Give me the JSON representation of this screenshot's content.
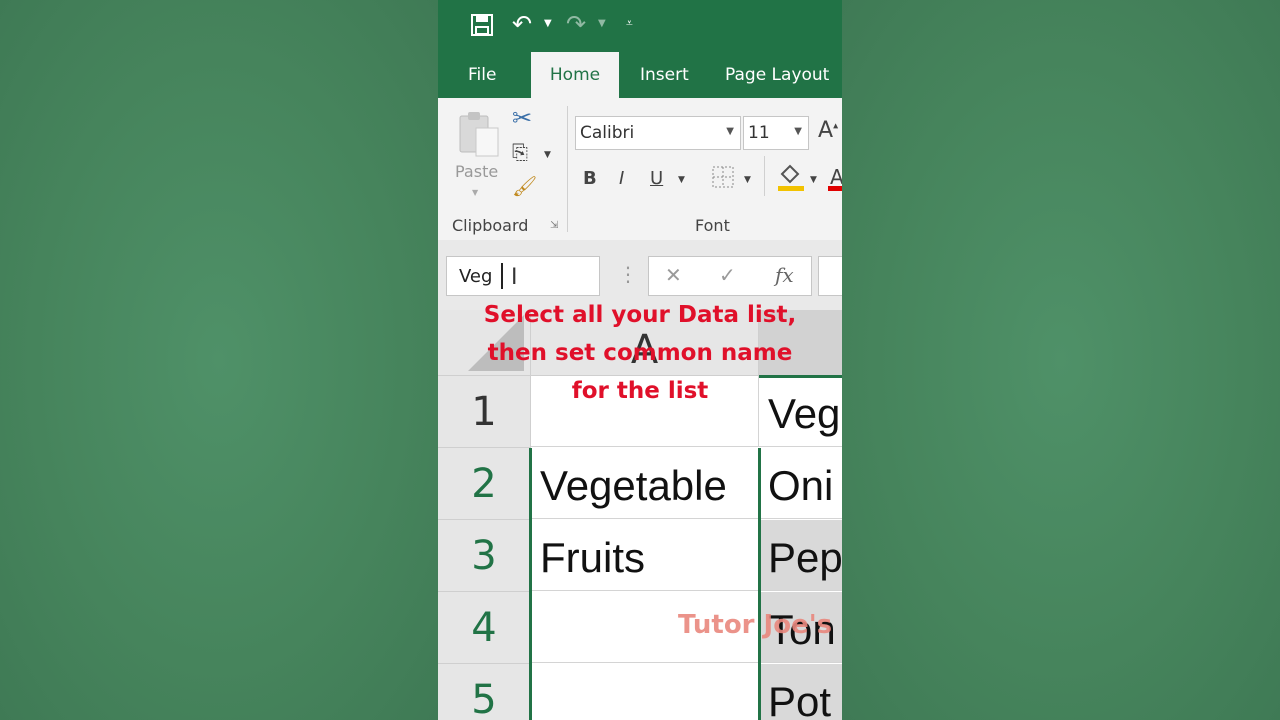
{
  "tabs": [
    {
      "label": "File",
      "active": false
    },
    {
      "label": "Home",
      "active": true
    },
    {
      "label": "Insert",
      "active": false
    },
    {
      "label": "Page Layout",
      "active": false
    }
  ],
  "ribbon": {
    "paste_label": "Paste",
    "clipboard_group": "Clipboard",
    "font_group": "Font",
    "font_name": "Calibri",
    "font_size": "11",
    "bold": "B",
    "italic": "I",
    "underline": "U"
  },
  "formula_bar": {
    "name_box_value": "Veg",
    "fx_label": "fx"
  },
  "sheet": {
    "columns": [
      "A"
    ],
    "rows": [
      {
        "num": "1",
        "a": "",
        "b": "Veg"
      },
      {
        "num": "2",
        "a": "Vegetable",
        "b": "Oni"
      },
      {
        "num": "3",
        "a": "Fruits",
        "b": "Pep"
      },
      {
        "num": "4",
        "a": "",
        "b": "Ton"
      },
      {
        "num": "5",
        "a": "",
        "b": "Pot"
      }
    ]
  },
  "overlay": {
    "line1": "Select all your Data list,",
    "line2": "then set common name",
    "line3": "for the list"
  },
  "watermark": "Tutor Joe's",
  "colors": {
    "excel_green": "#217346",
    "overlay_red": "#e0102a",
    "background_green": "#4a8a62"
  }
}
